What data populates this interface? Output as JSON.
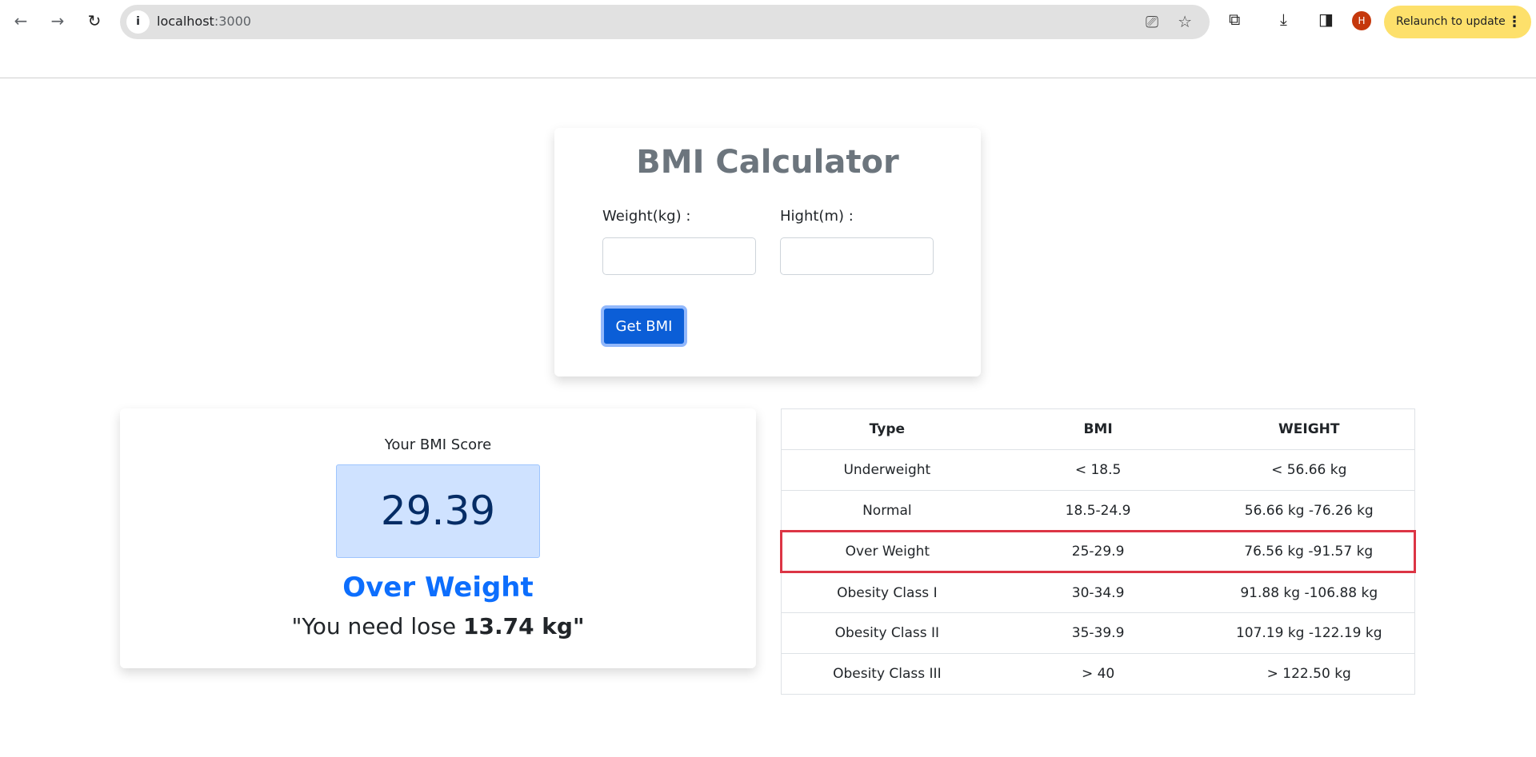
{
  "browser": {
    "url_host": "localhost",
    "url_port": ":3000",
    "relaunch_label": "Relaunch to update",
    "avatar_letter": "H"
  },
  "calculator": {
    "title": "BMI Calculator",
    "weight_label": "Weight(kg) :",
    "height_label": "Hight(m) :",
    "weight_value": "",
    "height_value": "",
    "button_label": "Get BMI"
  },
  "result": {
    "score_label": "Your BMI Score",
    "score": "29.39",
    "status": "Over Weight",
    "advice_prefix": "\"You need lose ",
    "advice_amount": "13.74 kg",
    "advice_suffix": "\"",
    "status_color": "#0d6efd"
  },
  "table": {
    "headers": [
      "Type",
      "BMI",
      "WEIGHT"
    ],
    "rows": [
      [
        "Underweight",
        "< 18.5",
        "< 56.66 kg"
      ],
      [
        "Normal",
        "18.5-24.9",
        "56.66 kg -76.26 kg"
      ],
      [
        "Over Weight",
        "25-29.9",
        "76.56 kg -91.57 kg"
      ],
      [
        "Obesity Class I",
        "30-34.9",
        "91.88 kg -106.88 kg"
      ],
      [
        "Obesity Class II",
        "35-39.9",
        "107.19 kg -122.19 kg"
      ],
      [
        "Obesity Class III",
        "> 40",
        "> 122.50 kg"
      ]
    ],
    "highlighted_row": "Over Weight",
    "highlight_color": "#dc3545"
  }
}
